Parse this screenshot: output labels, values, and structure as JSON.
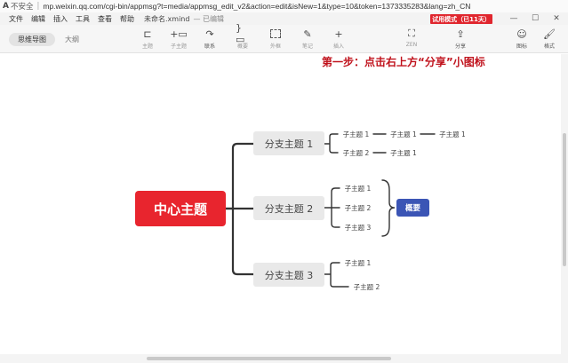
{
  "browser": {
    "warning_glyph": "A",
    "insecure_label": "不安全",
    "separator": "|",
    "url": "mp.weixin.qq.com/cgi-bin/appmsg?t=media/appmsg_edit_v2&action=edit&isNew=1&type=10&token=1373335283&lang=zh_CN"
  },
  "menubar": {
    "items": [
      "文件",
      "编辑",
      "插入",
      "工具",
      "查看",
      "帮助"
    ],
    "document_name": "未命名.xmind",
    "save_status": "— 已编辑",
    "trial_badge": "试用模式（已11天）",
    "window_controls": {
      "minimize": "—",
      "maximize": "☐",
      "close": "✕"
    }
  },
  "toolbar": {
    "view_tabs": [
      "思维导图",
      "大纲"
    ],
    "tools": {
      "topic": "主题",
      "subtopic": "子主题",
      "relationship": "联系",
      "summary": "概要",
      "boundary": "外框",
      "note": "笔记",
      "insert": "插入",
      "zen": "ZEN",
      "share": "分享",
      "icon": "图标",
      "format": "格式"
    },
    "icons": {
      "topic_glyph": "⊏",
      "subtopic_glyph": "+▭",
      "relationship_glyph": "↷",
      "summary_glyph": "}▭",
      "note_glyph": "✎",
      "insert_glyph": "+",
      "zen_glyph": "⛶",
      "share_glyph": "⇪",
      "icon_glyph": "☺",
      "format_glyph": "🖌"
    }
  },
  "hint_text": "第一步：点击右上方“分享”小图标",
  "mindmap": {
    "central": "中心主题",
    "branches": [
      {
        "label": "分支主题 1",
        "children": [
          {
            "label": "子主题 1",
            "chain": [
              "子主题 1",
              "子主题 1"
            ]
          },
          {
            "label": "子主题 2",
            "chain": [
              "子主题 1"
            ]
          }
        ]
      },
      {
        "label": "分支主题 2",
        "children": [
          {
            "label": "子主题 1"
          },
          {
            "label": "子主题 2"
          },
          {
            "label": "子主题 3"
          }
        ],
        "summary": "概要"
      },
      {
        "label": "分支主题 3",
        "children": [
          {
            "label": "子主题 1"
          },
          {
            "label": "子主题 2"
          }
        ]
      }
    ]
  },
  "colors": {
    "central_fill": "#e8252e",
    "summary_fill": "#3b55b5",
    "hint_text": "#c0121c",
    "trial_badge": "#e0262e",
    "connector": "#333333"
  }
}
